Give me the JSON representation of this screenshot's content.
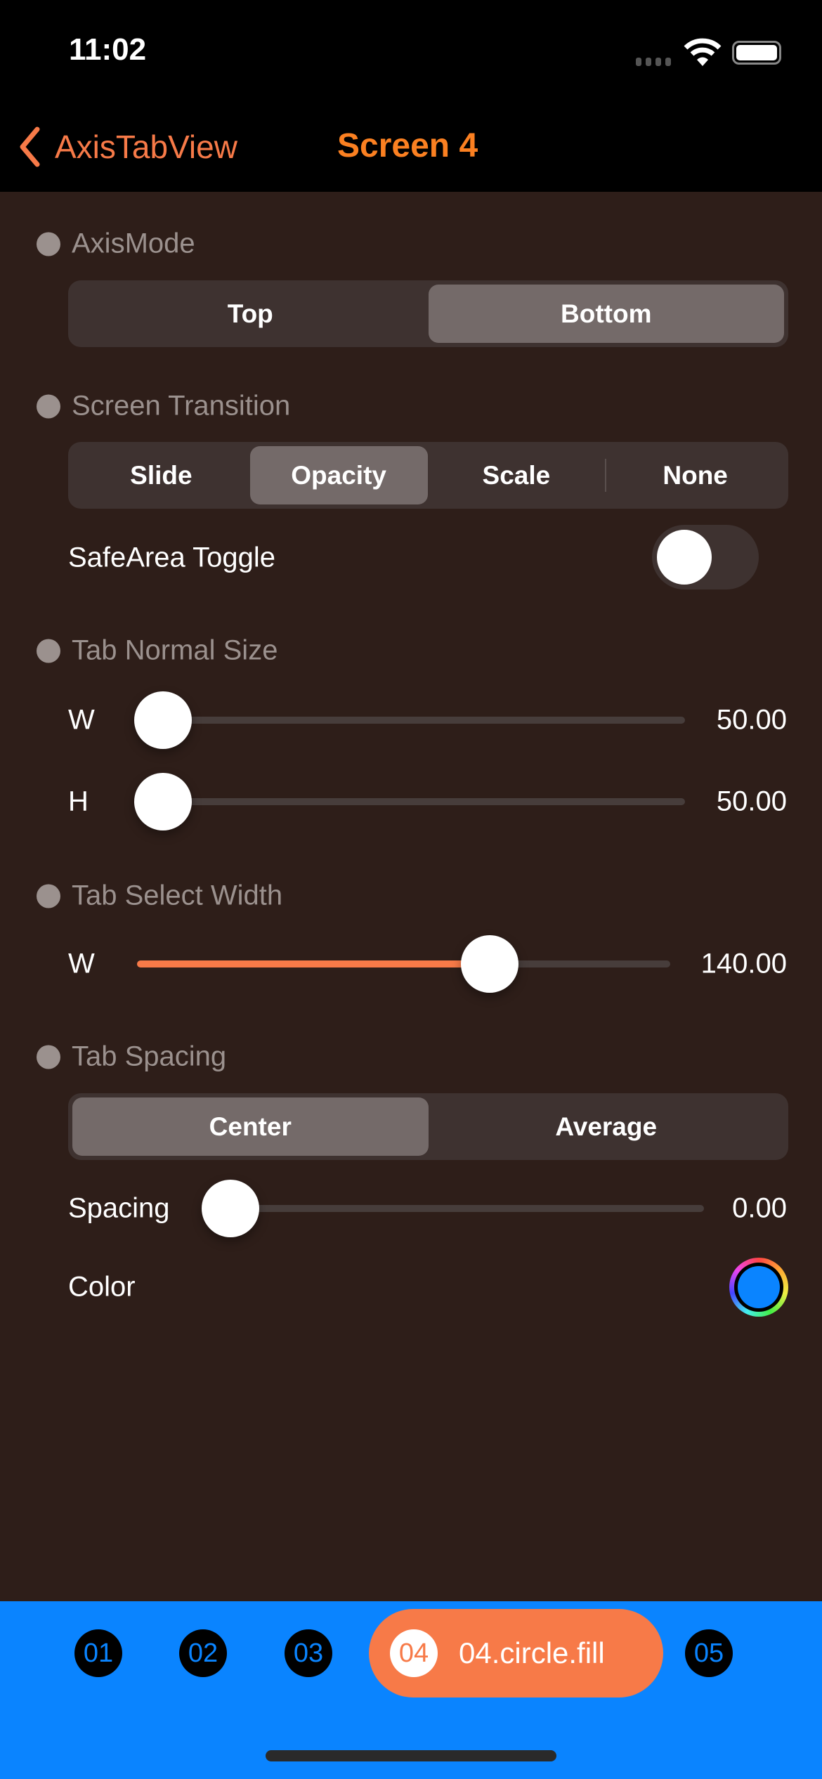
{
  "status": {
    "time": "11:02"
  },
  "nav": {
    "back_label": "AxisTabView",
    "title": "Screen 4"
  },
  "colors": {
    "accent": "#f77a48",
    "title": "#fb8021",
    "background": "#2e1e19",
    "tabbar": "#0a84ff",
    "selected_color": "#0a84ff"
  },
  "axis_mode": {
    "label": "AxisMode",
    "options": [
      "Top",
      "Bottom"
    ],
    "selected": "Bottom"
  },
  "transition": {
    "label": "Screen Transition",
    "options": [
      "Slide",
      "Opacity",
      "Scale",
      "None"
    ],
    "selected": "Opacity"
  },
  "safe_area": {
    "label": "SafeArea Toggle",
    "on": false
  },
  "normal_size": {
    "label": "Tab Normal Size",
    "w_label": "W",
    "w_value": "50.00",
    "w_fraction": 0,
    "h_label": "H",
    "h_value": "50.00",
    "h_fraction": 0
  },
  "select_width": {
    "label": "Tab Select Width",
    "w_label": "W",
    "w_value": "140.00",
    "w_fraction": 0.68
  },
  "spacing": {
    "label": "Tab Spacing",
    "options": [
      "Center",
      "Average"
    ],
    "selected": "Center",
    "spacing_label": "Spacing",
    "spacing_value": "0.00",
    "spacing_fraction": 0,
    "color_label": "Color"
  },
  "tabs": {
    "items": [
      "01",
      "02",
      "03",
      "04",
      "05"
    ],
    "selected_label": "04.circle.fill"
  }
}
